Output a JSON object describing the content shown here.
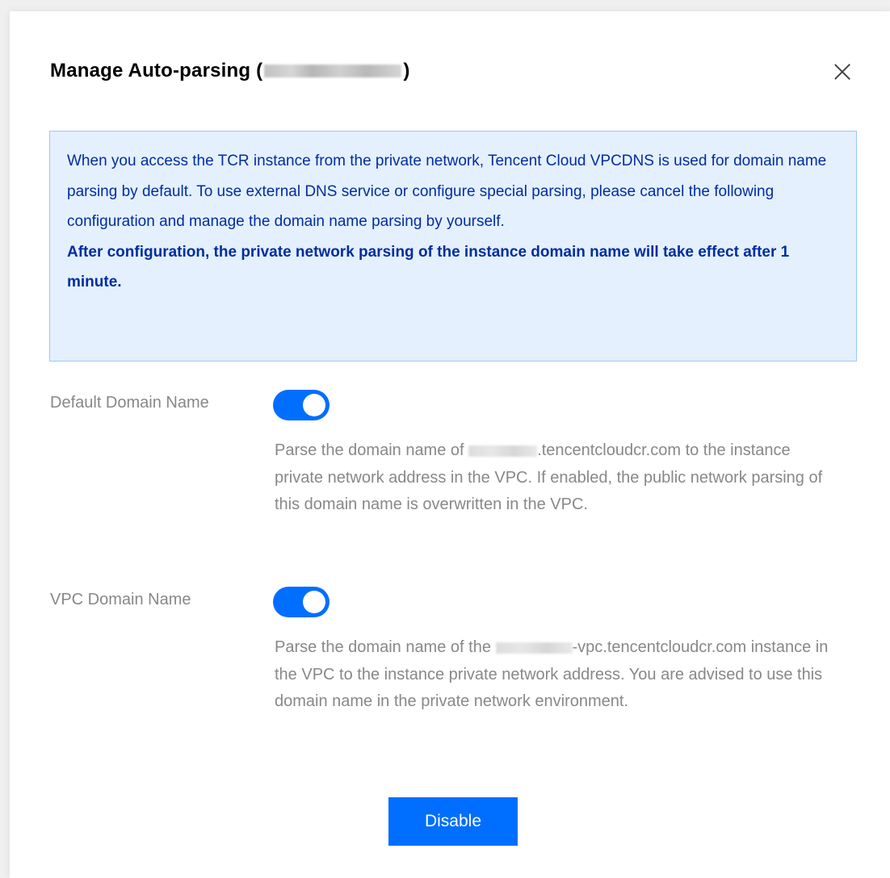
{
  "dialog": {
    "title_prefix": "Manage Auto-parsing (",
    "title_suffix": ")",
    "close_label": "×"
  },
  "notice": {
    "text": "When you access the TCR instance from the private network, Tencent Cloud VPCDNS is used for domain name parsing by default. To use external DNS service or configure special parsing, please cancel the following configuration and manage the domain name parsing by yourself.",
    "emphasis": "After configuration, the private network parsing of the instance domain name will take effect after 1 minute."
  },
  "settings": [
    {
      "label": "Default Domain Name",
      "enabled": true,
      "desc_before": "Parse the domain name of ",
      "desc_after": ".tencentcloudcr.com to the instance private network address in the VPC. If enabled, the public network parsing of this domain name is overwritten in the VPC."
    },
    {
      "label": "VPC Domain Name",
      "enabled": true,
      "desc_before": "Parse the domain name of the ",
      "desc_after": "-vpc.tencentcloudcr.com instance in the VPC to the instance private network address. You are advised to use this domain name in the private network environment."
    }
  ],
  "footer": {
    "disable_label": "Disable"
  },
  "colors": {
    "accent": "#006eff",
    "notice_bg": "#e5f0ff",
    "notice_border": "#97c7ff",
    "notice_text": "#002da0",
    "muted_text": "#888888"
  }
}
